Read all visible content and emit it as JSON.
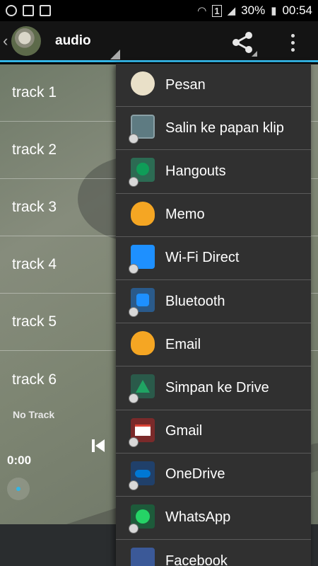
{
  "status_bar": {
    "battery": "30%",
    "time": "00:54",
    "sim_badge": "1",
    "left_icons": [
      "whatsapp-icon",
      "gallery-icon",
      "sim-lock-icon"
    ],
    "right_icons": [
      "wifi-icon",
      "sim-icon",
      "signal-icon",
      "battery-icon"
    ]
  },
  "action_bar": {
    "title": "audio",
    "icons": [
      "back-chevron-icon",
      "app-avatar",
      "share-icon",
      "overflow-menu-icon"
    ]
  },
  "tracks": [
    {
      "label": "track 1"
    },
    {
      "label": "track 2"
    },
    {
      "label": "track 3"
    },
    {
      "label": "track 4"
    },
    {
      "label": "track 5"
    },
    {
      "label": "track 6"
    }
  ],
  "player": {
    "now_playing": "No Track",
    "time": "0:00"
  },
  "share_menu": {
    "items": [
      {
        "label": "Pesan",
        "icon": "messages-icon",
        "color": "#e9e0c8"
      },
      {
        "label": "Salin ke papan klip",
        "icon": "clipboard-icon",
        "color": "#5e7b82"
      },
      {
        "label": "Hangouts",
        "icon": "hangouts-icon",
        "color": "#0f9d58"
      },
      {
        "label": "Memo",
        "icon": "memo-icon",
        "color": "#f5a623"
      },
      {
        "label": "Wi-Fi Direct",
        "icon": "wifi-direct-icon",
        "color": "#1e90ff"
      },
      {
        "label": "Bluetooth",
        "icon": "bluetooth-icon",
        "color": "#1e90ff"
      },
      {
        "label": "Email",
        "icon": "email-icon",
        "color": "#f5a623"
      },
      {
        "label": "Simpan ke Drive",
        "icon": "google-drive-icon",
        "color": "#1fa463"
      },
      {
        "label": "Gmail",
        "icon": "gmail-icon",
        "color": "#db4437"
      },
      {
        "label": "OneDrive",
        "icon": "onedrive-icon",
        "color": "#0078d4"
      },
      {
        "label": "WhatsApp",
        "icon": "whatsapp-icon",
        "color": "#25d366"
      },
      {
        "label": "Facebook",
        "icon": "facebook-icon",
        "color": "#3b5998"
      }
    ]
  },
  "colors": {
    "accent": "#33b5e5",
    "menu_bg": "#303030"
  }
}
